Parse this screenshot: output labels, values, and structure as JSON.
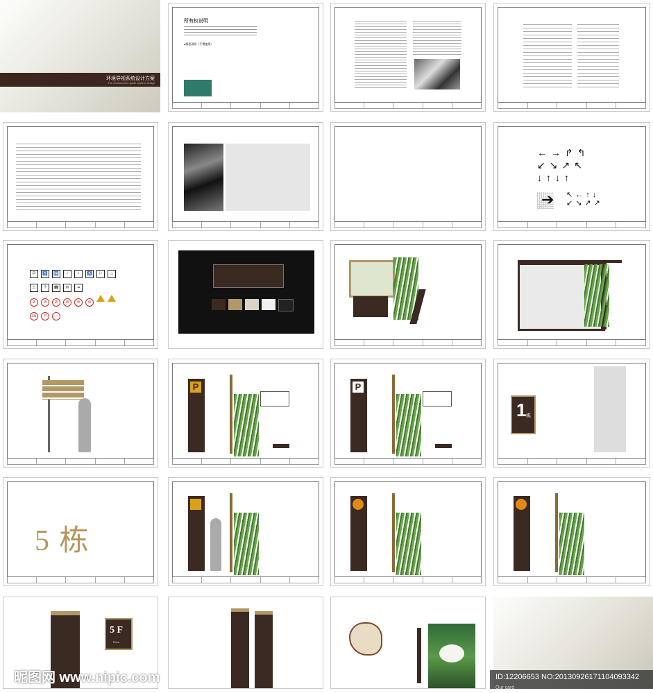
{
  "cover": {
    "title": "环境导视系统设计方案",
    "subtitle": "The environment guide system design"
  },
  "copyright_page": {
    "heading": "所有权说明",
    "subheading": "●版权说明（不得使用）"
  },
  "big_number": "5 栋",
  "sign_1": {
    "number": "1",
    "unit": "栋"
  },
  "sign_5f": {
    "text": "5 F",
    "label": "Floor"
  },
  "sign_parking": "P",
  "watermark_left": "昵图网 www.nipic.com",
  "watermark_right": "ID:12206653 NO:20130926171104093342",
  "watermark_right_sub": "Our card",
  "colors": {
    "dark_brown": "#3b2a22",
    "gold": "#b8965a",
    "cover_band": "#3c2620"
  }
}
